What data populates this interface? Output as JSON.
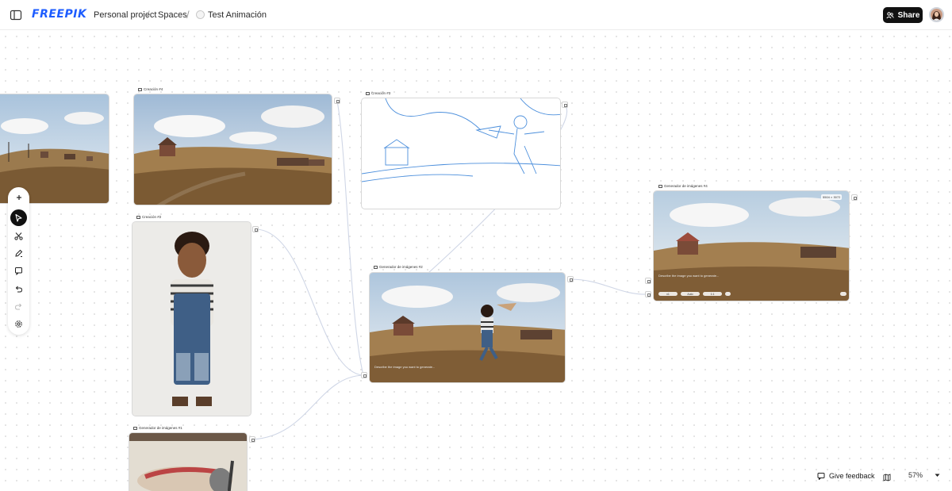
{
  "header": {
    "logo_text": "FREEPIK",
    "breadcrumbs": [
      {
        "label": "Personal project"
      },
      {
        "label": "Spaces"
      },
      {
        "label": "Test Animación"
      }
    ],
    "separator": "/",
    "share_label": "Share"
  },
  "nodes": {
    "left_partial": {
      "label": ""
    },
    "creacion_4": {
      "label": "Creación #4"
    },
    "creacion_3": {
      "label": "Creación #3"
    },
    "creacion_2": {
      "label": "Creación #2"
    },
    "generador_1": {
      "label": "Generador de imágenes #1"
    },
    "generador_2": {
      "label": "Generador de imágenes #2",
      "prompt_placeholder": "Describe the image you want to generate..."
    },
    "generador_4": {
      "label": "Generador de imágenes #4",
      "dimensions": "5504 × 3072",
      "prompt_placeholder": "Describe the image you want to generate...",
      "chips": {
        "count": "x1",
        "mode": "Auto",
        "ratio": "1:1"
      }
    }
  },
  "toolbar": {
    "tools": [
      {
        "name": "add-icon"
      },
      {
        "name": "select-icon",
        "active": true
      },
      {
        "name": "scissors-icon"
      },
      {
        "name": "pen-icon"
      },
      {
        "name": "comment-icon"
      },
      {
        "name": "undo-icon"
      },
      {
        "name": "redo-icon"
      },
      {
        "name": "settings-icon"
      }
    ]
  },
  "footer": {
    "feedback_label": "Give feedback",
    "zoom_level": "57%"
  },
  "colors": {
    "brand": "#1d5cff",
    "share_bg": "#111111",
    "edge": "#cfd6e6",
    "sketch": "#4c8fdc"
  }
}
